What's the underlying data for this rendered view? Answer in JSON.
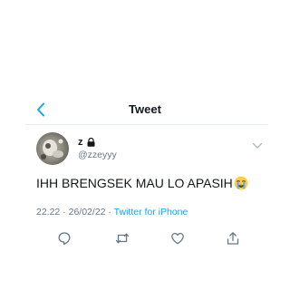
{
  "header": {
    "title": "Tweet",
    "back_icon": "chevron-left-icon"
  },
  "tweet": {
    "display_name": "z",
    "handle": "@zzeyyy",
    "protected_icon": "lock-icon",
    "text": "IHH BRENGSEK MAU LO APASIH",
    "emoji": "loudly-crying-face-icon",
    "time": "22.22",
    "date": "26/02/22",
    "separator1": " · ",
    "separator2": " · ",
    "client": "Twitter for iPhone"
  },
  "actions": [
    "reply-icon",
    "retweet-icon",
    "like-icon",
    "share-icon"
  ],
  "colors": {
    "accent": "#1da1f2",
    "text": "#14171a",
    "secondary": "#657786",
    "divider": "#e6ecf0"
  }
}
